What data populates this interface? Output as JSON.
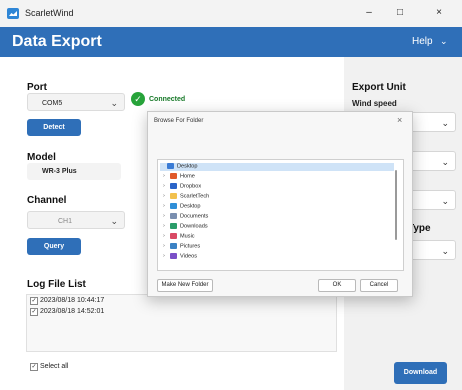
{
  "window": {
    "app_name": "ScarletWind",
    "controls": [
      "–",
      "□",
      "×"
    ]
  },
  "header": {
    "title": "Data Export",
    "help_label": "Help",
    "help_chevron": "⌄"
  },
  "port": {
    "label": "Port",
    "value": "COM5",
    "status": "Connected",
    "detect_label": "Detect"
  },
  "model": {
    "label": "Model",
    "value": "WR-3 Plus"
  },
  "channel": {
    "label": "Channel",
    "value": "CH1",
    "query_label": "Query"
  },
  "log": {
    "label": "Log File List",
    "items": [
      {
        "text": "2023/08/18 10:44:17",
        "checked": true
      },
      {
        "text": "2023/08/18 14:52:01",
        "checked": true
      }
    ],
    "select_all_label": "Select all"
  },
  "export_unit": {
    "label": "Export Unit",
    "wind_speed_label": "Wind speed",
    "partial_label_1": "e",
    "partial_label_2": "Type"
  },
  "download_label": "Download",
  "dialog": {
    "title": "Browse For Folder",
    "tree": [
      {
        "label": "Desktop",
        "icon": "desktop-folder-icon",
        "color": "#3a7bd5",
        "selected": true,
        "indent": 0
      },
      {
        "label": "Home",
        "icon": "home-icon",
        "color": "#e05a2b",
        "indent": 1
      },
      {
        "label": "Dropbox",
        "icon": "dropbox-icon",
        "color": "#2a64c8",
        "indent": 1
      },
      {
        "label": "ScarletTech",
        "icon": "folder-icon",
        "color": "#f2c14e",
        "indent": 1
      },
      {
        "label": "Desktop",
        "icon": "desktop-folder-icon",
        "color": "#2f8fd8",
        "indent": 1
      },
      {
        "label": "Documents",
        "icon": "documents-icon",
        "color": "#7a8fb0",
        "indent": 1
      },
      {
        "label": "Downloads",
        "icon": "downloads-icon",
        "color": "#2a9d6a",
        "indent": 1
      },
      {
        "label": "Music",
        "icon": "music-icon",
        "color": "#d94a64",
        "indent": 1
      },
      {
        "label": "Pictures",
        "icon": "pictures-icon",
        "color": "#3b82c4",
        "indent": 1
      },
      {
        "label": "Videos",
        "icon": "videos-icon",
        "color": "#7a4fc7",
        "indent": 1
      }
    ],
    "make_new_folder_label": "Make New Folder",
    "ok_label": "OK",
    "cancel_label": "Cancel"
  }
}
